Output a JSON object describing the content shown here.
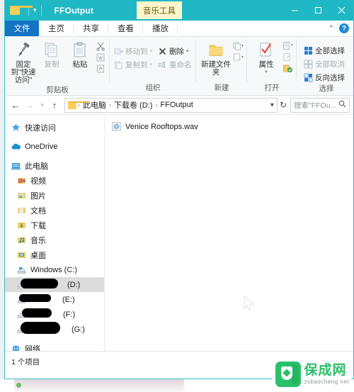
{
  "window": {
    "title": "FFOutput",
    "contextual_tab": "音乐工具",
    "quick_access_arrow": "▾",
    "controls": {
      "minimize": "minimize-icon",
      "maximize": "maximize-icon",
      "close": "close-icon"
    }
  },
  "ribbon": {
    "tabs": [
      {
        "label": "文件",
        "active": true,
        "style": "file"
      },
      {
        "label": "主页",
        "active": false
      },
      {
        "label": "共享",
        "active": false
      },
      {
        "label": "查看",
        "active": false
      },
      {
        "label": "播放",
        "active": false
      }
    ],
    "collapse_icon": "chevron-up-icon",
    "help_icon": "?",
    "groups": [
      {
        "name": "clipboard",
        "label": "剪贴板",
        "big_buttons": [
          {
            "label": "固定到\"快速访问\"",
            "icon": "pin-icon",
            "disabled": false
          },
          {
            "label": "复制",
            "icon": "copy-icon",
            "disabled": true
          },
          {
            "label": "粘贴",
            "icon": "paste-icon",
            "disabled": false
          }
        ],
        "small_icons": [
          {
            "name": "cut-icon"
          },
          {
            "name": "copy-path-icon"
          },
          {
            "name": "paste-shortcut-icon"
          }
        ]
      },
      {
        "name": "organize",
        "label": "组织",
        "items": [
          {
            "label": "移动到",
            "icon": "move-to-icon",
            "caret": "▾",
            "disabled": true
          },
          {
            "label": "删除",
            "icon": "delete-icon",
            "caret": "▾",
            "disabled": false
          },
          {
            "label": "复制到",
            "icon": "copy-to-icon",
            "caret": "▾",
            "disabled": true
          },
          {
            "label": "重命名",
            "icon": "rename-icon",
            "caret": "",
            "disabled": true
          }
        ]
      },
      {
        "name": "new",
        "label": "新建",
        "big_buttons": [
          {
            "label": "新建文件夹",
            "icon": "new-folder-icon",
            "disabled": false
          }
        ],
        "small_icons": [
          {
            "name": "new-item-icon",
            "caret": "▾"
          },
          {
            "name": "easy-access-icon",
            "caret": "▾"
          }
        ]
      },
      {
        "name": "open",
        "label": "打开",
        "big_buttons": [
          {
            "label": "属性",
            "icon": "properties-icon",
            "caret": "▾",
            "disabled": false
          }
        ],
        "small_icons": [
          {
            "name": "open-with-icon",
            "caret": "▾"
          },
          {
            "name": "edit-icon"
          },
          {
            "name": "history-icon"
          }
        ]
      },
      {
        "name": "select",
        "label": "选择",
        "items": [
          {
            "label": "全部选择",
            "icon": "select-all-icon",
            "disabled": false
          },
          {
            "label": "全部取消",
            "icon": "select-none-icon",
            "disabled": true
          },
          {
            "label": "反向选择",
            "icon": "invert-selection-icon",
            "disabled": false
          }
        ]
      }
    ]
  },
  "addressbar": {
    "back_icon": "←",
    "forward_icon": "→",
    "recent_icon": "▾",
    "up_icon": "↑",
    "breadcrumbs": [
      "此电脑",
      "下载卷 (D:)",
      "FFOutput"
    ],
    "separator": "›",
    "dropdown_icon": "▾",
    "refresh_icon": "↻",
    "search_placeholder": "搜索\"FFOu...",
    "search_icon": "search-icon",
    "search_value": ""
  },
  "navpane": {
    "items": [
      {
        "label": "快速访问",
        "icon": "star-icon",
        "indent": 0,
        "selected": false
      },
      {
        "label": "OneDrive",
        "icon": "onedrive-cloud-icon",
        "indent": 0,
        "selected": false
      },
      {
        "label": "此电脑",
        "icon": "this-pc-icon",
        "indent": 0,
        "selected": false
      },
      {
        "label": "视频",
        "icon": "videos-folder-icon",
        "indent": 1,
        "selected": false
      },
      {
        "label": "图片",
        "icon": "pictures-folder-icon",
        "indent": 1,
        "selected": false
      },
      {
        "label": "文档",
        "icon": "documents-folder-icon",
        "indent": 1,
        "selected": false
      },
      {
        "label": "下载",
        "icon": "downloads-folder-icon",
        "indent": 1,
        "selected": false
      },
      {
        "label": "音乐",
        "icon": "music-folder-icon",
        "indent": 1,
        "selected": false
      },
      {
        "label": "桌面",
        "icon": "desktop-folder-icon",
        "indent": 1,
        "selected": false
      },
      {
        "label": "Windows (C:)",
        "icon": "system-drive-icon",
        "indent": 1,
        "selected": false
      },
      {
        "label": "(D:)",
        "icon": "drive-icon",
        "indent": 1,
        "selected": true,
        "redacted": true
      },
      {
        "label": "(E:)",
        "icon": "drive-icon",
        "indent": 1,
        "selected": false,
        "redacted": true
      },
      {
        "label": "(F:)",
        "icon": "drive-icon",
        "indent": 1,
        "selected": false,
        "redacted": true
      },
      {
        "label": "(G:)",
        "icon": "drive-icon",
        "indent": 1,
        "selected": false,
        "redacted": true
      },
      {
        "label": "网络",
        "icon": "network-icon",
        "indent": 0,
        "selected": false
      }
    ]
  },
  "filelist": {
    "items": [
      {
        "name": "Venice Rooftops.wav",
        "icon": "wav-audio-icon"
      }
    ]
  },
  "statusbar": {
    "text": "1 个项目"
  },
  "watermark": {
    "title": "保成网",
    "domain": "zsbaocheng.net",
    "color": "#2bc06a"
  },
  "colors": {
    "titlebar": "#1fb8c4",
    "file_tab": "#1473c4",
    "contextual_tab": "#fdf5cc",
    "selection": "#dcdcdc"
  }
}
